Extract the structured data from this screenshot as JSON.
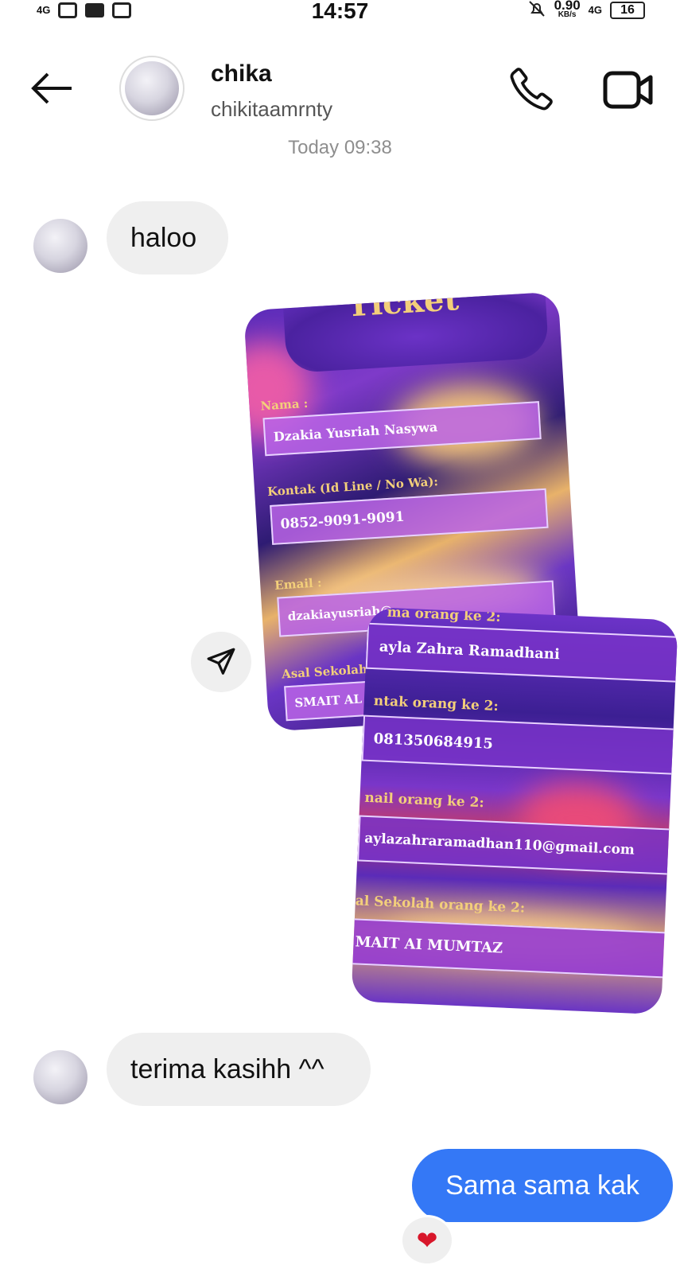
{
  "status_bar": {
    "network": "4G",
    "time": "14:57",
    "speed_value": "0.90",
    "speed_unit": "KB/s",
    "network_right": "4G",
    "battery": "16"
  },
  "header": {
    "name": "chika",
    "handle": "chikitaamrnty"
  },
  "timestamp": "Today 09:38",
  "messages": [
    {
      "from": "them",
      "text": "haloo"
    },
    {
      "from": "them",
      "text": "terima kasihh ^^"
    },
    {
      "from": "me",
      "text": "Sama sama kak"
    }
  ],
  "reaction": "heart",
  "ticket_1": {
    "title": "Ticket",
    "nama_label": "Nama :",
    "nama_value": "Dzakia Yusriah Nasywa",
    "kontak_label": "Kontak (Id Line / No Wa):",
    "kontak_value": "0852-9091-9091",
    "email_label": "Email :",
    "email_value": "dzakiayusriah@",
    "sekolah_label": "Asal Sekolah:",
    "sekolah_value": "SMAIT AL MU"
  },
  "ticket_2": {
    "nama_label": "ma orang ke 2:",
    "nama_value": "ayla Zahra Ramadhani",
    "kontak_label": "ntak orang ke 2:",
    "kontak_value": "081350684915",
    "email_label": "nail orang ke 2:",
    "email_value": "aylazahraramadhan110@gmail.com",
    "sekolah_label": "al Sekolah orang ke 2:",
    "sekolah_value": "MAIT AI MUMTAZ"
  },
  "colors": {
    "accent": "#3478f6",
    "bubble_in": "#efefef",
    "heart": "#d8162a"
  }
}
